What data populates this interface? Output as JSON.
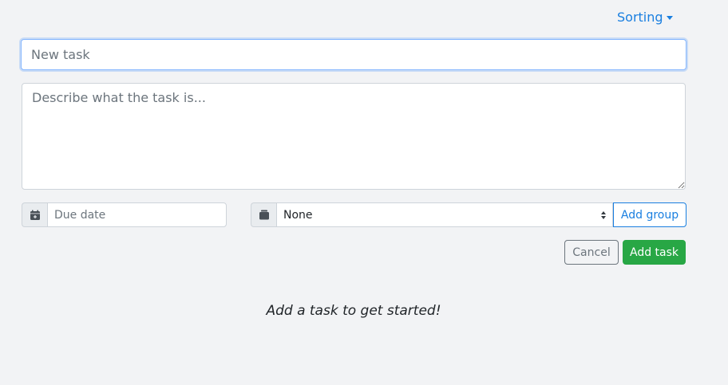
{
  "header": {
    "sorting_label": "Sorting"
  },
  "form": {
    "title_placeholder": "New task",
    "description_placeholder": "Describe what the task is...",
    "due_date_placeholder": "Due date",
    "group_selected": "None",
    "add_group_label": "Add group",
    "cancel_label": "Cancel",
    "add_task_label": "Add task"
  },
  "empty_state": {
    "message": "Add a task to get started!"
  },
  "icons": {
    "calendar": "calendar-plus-icon",
    "group": "folder-icon"
  },
  "colors": {
    "accent": "#1a7fe0",
    "success": "#28a745",
    "secondary": "#6c757d",
    "background": "#f2f3f5"
  }
}
